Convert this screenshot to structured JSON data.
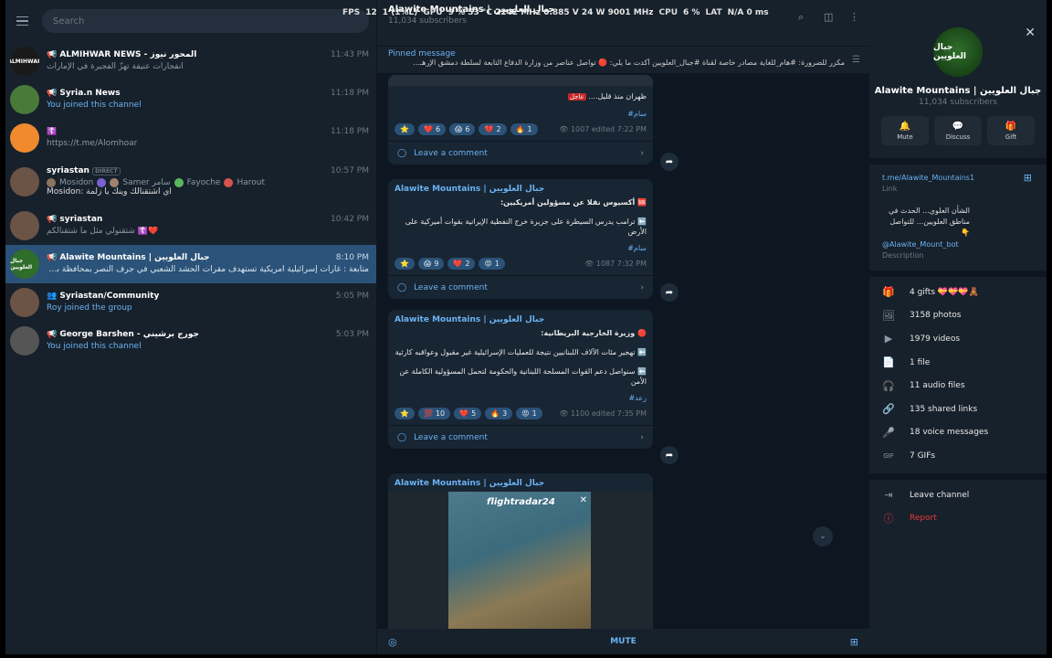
{
  "overlay": {
    "fps_label": "FPS",
    "fps_value": "12",
    "one_pct": "1 (1%L)",
    "gpu_label": "GPU",
    "gpu_value": "9 % 53 °C 2242 MHz 0.885 V 24 W 9001 MHz",
    "cpu_label": "CPU",
    "cpu_value": "6 %",
    "lat_label": "LAT",
    "lat_value": "N/A 0 ms"
  },
  "sidebar": {
    "search_placeholder": "Search",
    "chats": [
      {
        "name": "📢 ALMIHWAR NEWS - المحور نيوز",
        "time": "11:43 PM",
        "preview": "انفجارات عنيفة تهزّ الفجيرة في الإمارات",
        "avatar_text": "ALMIHWAR"
      },
      {
        "name": "📢 Syria.n News",
        "time": "11:18 PM",
        "preview": "You joined this channel",
        "avatar_text": ""
      },
      {
        "name": "☦️",
        "time": "11:18 PM",
        "preview": "https://t.me/Alomhoar",
        "avatar_text": ""
      },
      {
        "name": "syriastan",
        "badge": "DIRECT",
        "time": "10:57 PM",
        "members": [
          "Mosidon",
          "Samer سامر",
          "Fayoche",
          "Harout"
        ],
        "preview": "Mosidon: اي اشتقنالك وينك يا زلمة",
        "avatar_text": ""
      },
      {
        "name": "📢 syriastan",
        "time": "10:42 PM",
        "preview": "شتقنولي مثل ما شتقنالكم ☦️❤️",
        "avatar_text": ""
      },
      {
        "name": "📢 Alawite Mountains | جبال العلويين",
        "time": "8:10 PM",
        "preview": "متابعة : غارات إسرائيلية امريكية تستهدف مقرات الحشد الشعبي في جرف النصر بمحافظة بابل . #رعد",
        "avatar_text": "جبال العلويين"
      },
      {
        "name": "👥 Syriastan/Community",
        "time": "5:05 PM",
        "preview": "Roy joined the group",
        "avatar_text": ""
      },
      {
        "name": "📢 George Barshen - جورج برشيني",
        "time": "5:03 PM",
        "preview": "You joined this channel",
        "avatar_text": ""
      }
    ]
  },
  "channel": {
    "title": "Alawite Mountains | جبال العلويين",
    "subtitle": "11,034 subscribers",
    "pinned_title": "Pinned message",
    "pinned_text": "مكرر للضرورة: #هام_للغاية مصادر خاصة لقناة #جبال_العلويين أكدت ما يلي: 🔴 تواصل عناصر من وزارة الدفاع التابعة لسلطة دمشق الإرهـ...",
    "mute_label": "MUTE",
    "sender": "Alawite Mountains | جبال العلويين",
    "comment_label": "Leave a comment",
    "posts": [
      {
        "lines": [
          "ظهران منذ قليل...."
        ],
        "tag_prefix": "عاجل",
        "hashtag": "#سام",
        "reactions": [
          {
            "e": "⭐",
            "n": "6"
          },
          {
            "e": "❤️",
            "n": "6"
          },
          {
            "e": "😱",
            "n": "6"
          },
          {
            "e": "💔",
            "n": "2"
          },
          {
            "e": "🔥",
            "n": "1"
          }
        ],
        "views": "👁 1007",
        "meta": "edited 7:22 PM"
      },
      {
        "headline": "🆘 أكسيوس نقلا عن مسؤولين أمريكيين:",
        "lines": [
          "⬅️ ترامب يدرس السيطرة على جزيرة خرج النفطية الإيرانية بقوات أميركية على الأرض"
        ],
        "hashtag": "#سام",
        "reactions": [
          {
            "e": "⭐",
            "n": "9"
          },
          {
            "e": "😱",
            "n": "9"
          },
          {
            "e": "❤️",
            "n": "2"
          },
          {
            "e": "😡",
            "n": "1"
          }
        ],
        "views": "👁 1087",
        "meta": "7:32 PM"
      },
      {
        "headline": "🔴 وزيرة الخارجية البريطانية:",
        "lines": [
          "⬅️ تهجير مئات الآلاف اللبنانيين نتيجة للعمليات الإسرائيلية غير مقبول وعواقبه كارثية",
          "⬅️ سنواصل دعم القوات المسلحة اللبنانية والحكومة لتحمل المسؤولية الكاملة عن الأمن"
        ],
        "hashtag": "#رعد",
        "reactions": [
          {
            "e": "⭐",
            "n": ""
          },
          {
            "e": "💯",
            "n": "10"
          },
          {
            "e": "❤️",
            "n": "5"
          },
          {
            "e": "🔥",
            "n": "3"
          },
          {
            "e": "😡",
            "n": "1"
          }
        ],
        "views": "👁 1100",
        "meta": "edited 7:35 PM"
      }
    ],
    "image_brand": "flightradar24"
  },
  "info": {
    "name": "Alawite Mountains | جبال العلويين",
    "subs": "11,034 subscribers",
    "avatar_text": "جبال العلويين",
    "actions": [
      {
        "icon": "🔔",
        "label": "Mute"
      },
      {
        "icon": "💬",
        "label": "Discuss"
      },
      {
        "icon": "🎁",
        "label": "Gift"
      }
    ],
    "link": "t.me/Alawite_Mountains1",
    "link_label": "Link",
    "description": "الشأن العلوي... الحدث في مناطق العلويين... للتواصل 👇",
    "handle": "@Alawite_Mount_bot",
    "desc_label": "Description",
    "media": [
      {
        "icon": "🎁",
        "label": "4 gifts 💝💝💝🧸"
      },
      {
        "icon": "🖼",
        "label": "3158 photos"
      },
      {
        "icon": "▶",
        "label": "1979 videos"
      },
      {
        "icon": "📄",
        "label": "1 file"
      },
      {
        "icon": "🎧",
        "label": "11 audio files"
      },
      {
        "icon": "🔗",
        "label": "135 shared links"
      },
      {
        "icon": "🎤",
        "label": "18 voice messages"
      },
      {
        "icon": "GIF",
        "label": "7 GIFs"
      }
    ],
    "leave_label": "Leave channel",
    "report_label": "Report"
  }
}
